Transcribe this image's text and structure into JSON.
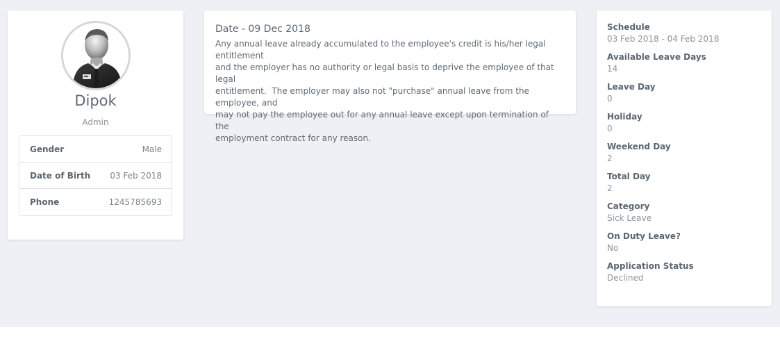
{
  "profile": {
    "name": "Dipok",
    "role": "Admin",
    "info": [
      {
        "label": "Gender",
        "value": "Male"
      },
      {
        "label": "Date of Birth",
        "value": "03 Feb 2018"
      },
      {
        "label": "Phone",
        "value": "1245785693"
      }
    ]
  },
  "message": {
    "date": "Date - 09 Dec 2018",
    "body": "Any annual leave already accumulated to the employee's credit is his/her legal entitlement\nand the employer has no authority or legal basis to deprive the employee of that legal\nentitlement.  The employer may also not \"purchase\" annual leave from the employee, and\nmay not pay the employee out for any annual leave except upon termination of the\nemployment contract for any reason."
  },
  "details": [
    {
      "label": "Schedule",
      "value": "03 Feb 2018 - 04 Feb 2018"
    },
    {
      "label": "Available Leave Days",
      "value": "14"
    },
    {
      "label": "Leave Day",
      "value": "0"
    },
    {
      "label": "Holiday",
      "value": "0"
    },
    {
      "label": "Weekend Day",
      "value": "2"
    },
    {
      "label": "Total Day",
      "value": "2"
    },
    {
      "label": "Category",
      "value": "Sick Leave"
    },
    {
      "label": "On Duty Leave?",
      "value": "No"
    },
    {
      "label": "Application Status",
      "value": "Declined"
    }
  ]
}
